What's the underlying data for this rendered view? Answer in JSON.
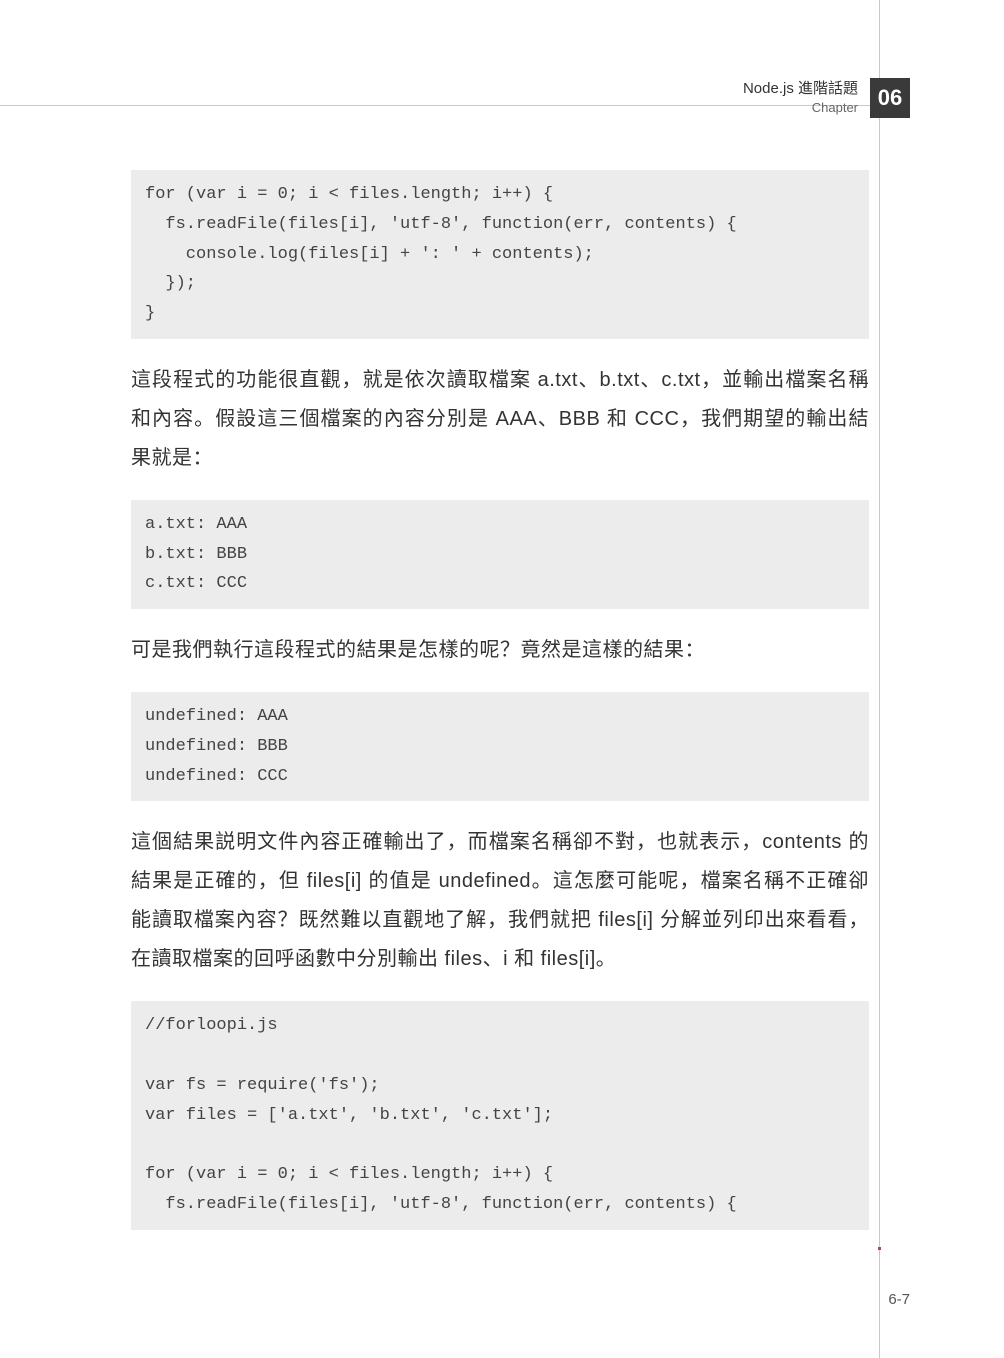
{
  "header": {
    "title": "Node.js 進階話題",
    "chapter_label": "Chapter",
    "chapter_number": "06"
  },
  "code1": "for (var i = 0; i < files.length; i++) {\n  fs.readFile(files[i], 'utf-8', function(err, contents) {\n    console.log(files[i] + ': ' + contents);\n  });\n}",
  "para1": "這段程式的功能很直觀，就是依次讀取檔案 a.txt、b.txt、c.txt，並輸出檔案名稱和內容。假設這三個檔案的內容分別是 AAA、BBB 和 CCC，我們期望的輸出結果就是：",
  "code2": "a.txt: AAA\nb.txt: BBB\nc.txt: CCC",
  "para2": "可是我們執行這段程式的結果是怎樣的呢？竟然是這樣的結果：",
  "code3": "undefined: AAA\nundefined: BBB\nundefined: CCC",
  "para3": "這個結果説明文件內容正確輸出了，而檔案名稱卻不對，也就表示，contents 的結果是正確的，但 files[i] 的值是 undefined。這怎麼可能呢，檔案名稱不正確卻能讀取檔案內容？既然難以直觀地了解，我們就把 files[i] 分解並列印出來看看，在讀取檔案的回呼函數中分別輸出 files、i 和 files[i]。",
  "code4": "//forloopi.js\n\nvar fs = require('fs');\nvar files = ['a.txt', 'b.txt', 'c.txt'];\n\nfor (var i = 0; i < files.length; i++) {\n  fs.readFile(files[i], 'utf-8', function(err, contents) {",
  "page_number": "6-7"
}
